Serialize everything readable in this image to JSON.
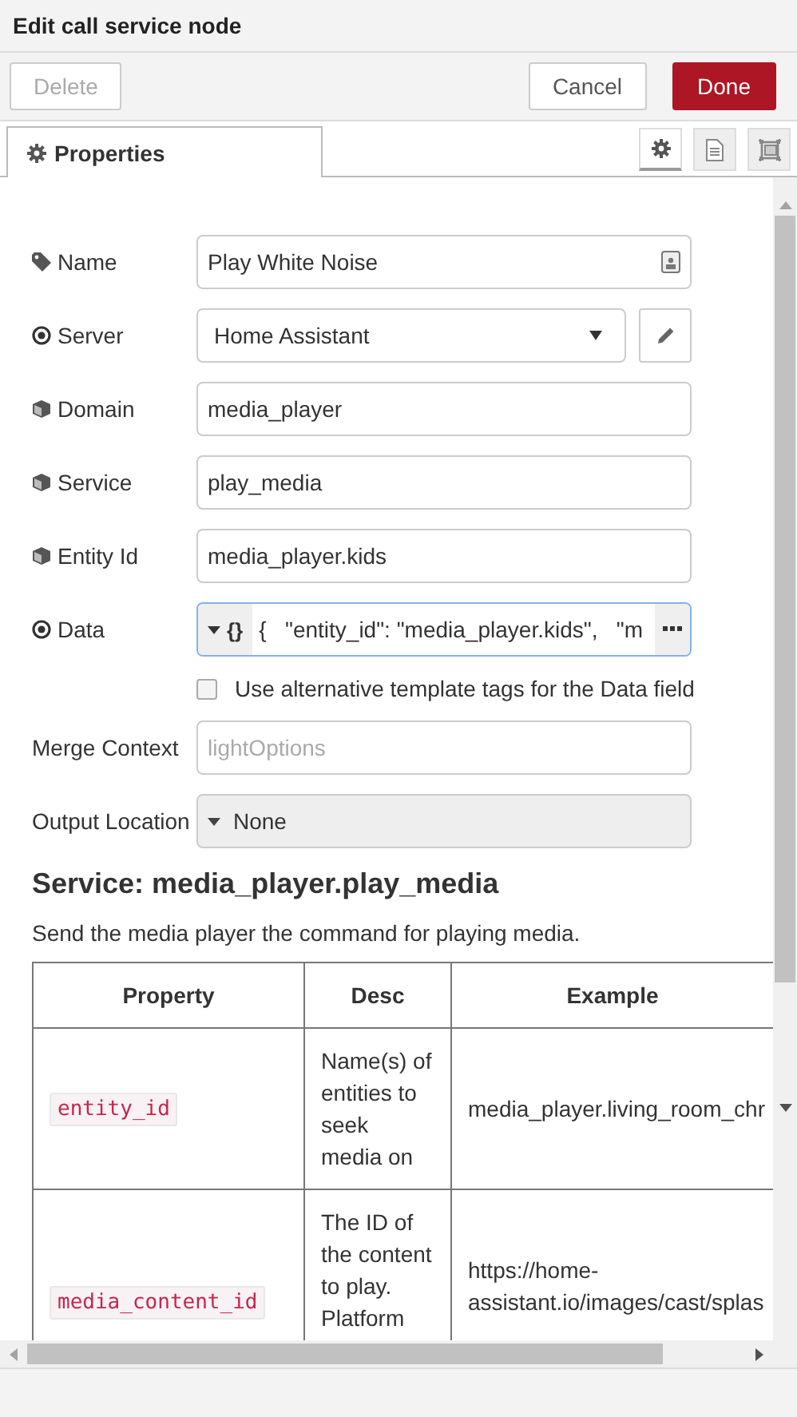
{
  "dialog": {
    "title": "Edit call service node"
  },
  "buttons": [
    {
      "label": "Delete",
      "kind": "secondary",
      "disabled": true
    },
    {
      "label": "Cancel",
      "kind": "secondary",
      "disabled": false
    },
    {
      "label": "Done",
      "kind": "primary",
      "disabled": false
    }
  ],
  "tabs": [
    {
      "label": "Properties",
      "selected": true
    }
  ],
  "tab_buttons": [
    {
      "kind": "settings",
      "selected": true
    },
    {
      "kind": "description",
      "selected": false
    },
    {
      "kind": "appearance",
      "selected": false
    }
  ],
  "fields": [
    {
      "label": "Name",
      "kind": "text",
      "value": "Play White Noise"
    },
    {
      "label": "Server",
      "kind": "select",
      "value": "Home Assistant"
    },
    {
      "label": "Domain",
      "kind": "text",
      "value": "media_player"
    },
    {
      "label": "Service",
      "kind": "text",
      "value": "play_media"
    },
    {
      "label": "Entity Id",
      "kind": "text",
      "value": "media_player.kids"
    },
    {
      "label": "Data",
      "kind": "typed",
      "type_label": "{}",
      "value": "{   \"entity_id\": \"media_player.kids\",   \"m"
    },
    {
      "label": "Use alternative template tags for the Data field",
      "kind": "checkbox",
      "checked": false
    },
    {
      "label": "Merge Context",
      "kind": "text",
      "placeholder": "lightOptions"
    },
    {
      "label": "Output Location",
      "kind": "dropdown",
      "value": "None"
    }
  ],
  "service": {
    "heading": "Service: media_player.play_media",
    "description": "Send the media player the command for playing media."
  },
  "table": {
    "columns": [
      "Property",
      "Desc",
      "Example"
    ],
    "rows": [
      {
        "property": "entity_id",
        "desc": "Name(s) of entities to seek media on",
        "example": "media_player.living_room_chr"
      },
      {
        "property": "media_content_id",
        "desc": "The ID of the content to play. Platform",
        "example": "https://home-assistant.io/images/cast/splas"
      }
    ]
  }
}
